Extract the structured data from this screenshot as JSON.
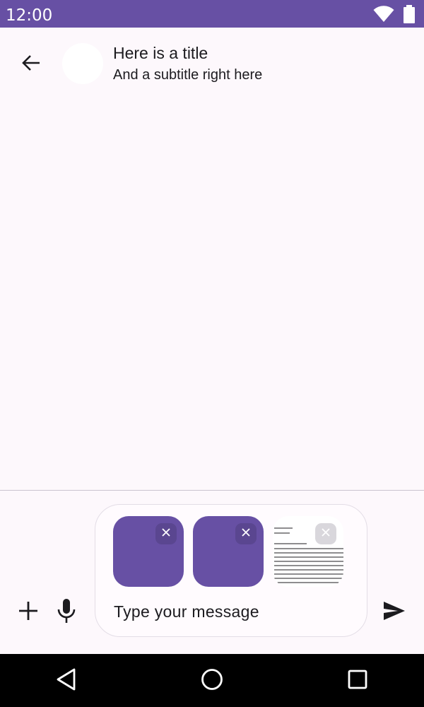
{
  "status_bar": {
    "time": "12:00",
    "icons": [
      "wifi-icon",
      "battery-icon"
    ],
    "color": "#6750a4"
  },
  "header": {
    "back_icon": "arrow-back-icon",
    "title": "Here is a title",
    "subtitle": "And a subtitle right here"
  },
  "composer": {
    "placeholder": "Type your message",
    "attachments": [
      {
        "kind": "image",
        "color": "#6750a4",
        "remove_icon": "close-icon"
      },
      {
        "kind": "image",
        "color": "#6750a4",
        "remove_icon": "close-icon"
      },
      {
        "kind": "document",
        "color": "#ffffff",
        "remove_icon": "close-icon"
      }
    ],
    "left_icons": [
      "add-icon",
      "mic-icon"
    ],
    "send_icon": "send-icon"
  },
  "nav_bar": {
    "icons": [
      "nav-back-icon",
      "nav-home-icon",
      "nav-recents-icon"
    ]
  },
  "colors": {
    "accent": "#6750a4",
    "background": "#fdf8fc",
    "text": "#1c1b1f"
  }
}
